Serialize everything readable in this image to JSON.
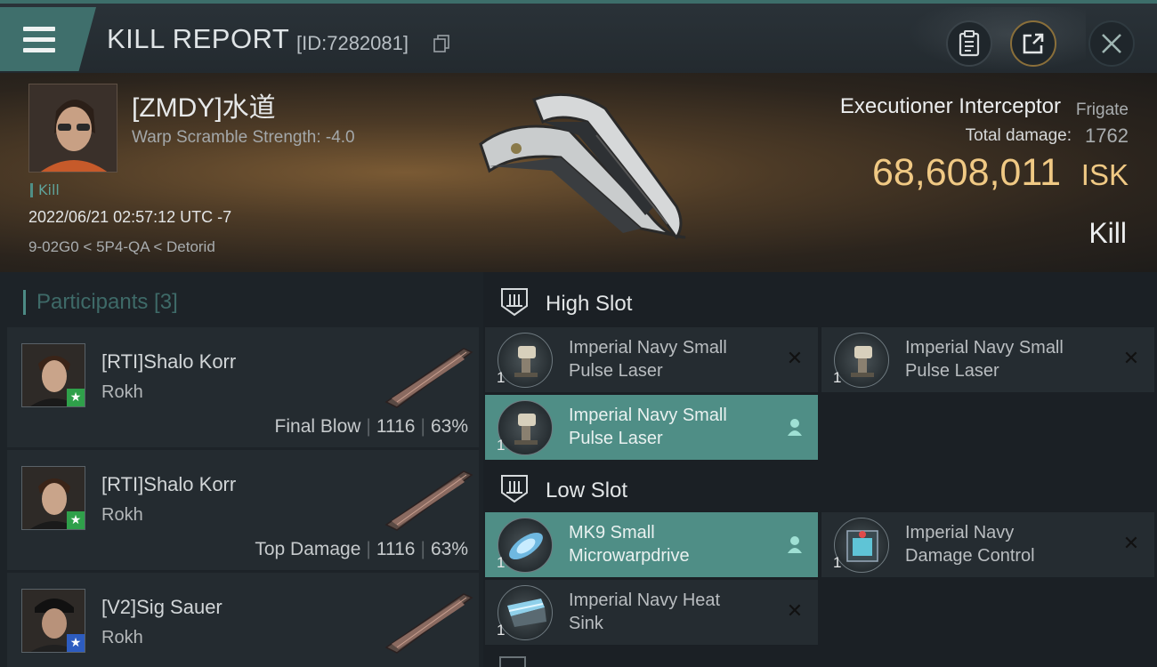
{
  "header": {
    "title": "KILL REPORT",
    "report_id": "[ID:7282081]"
  },
  "victim": {
    "name": "[ZMDY]水道",
    "warp_scramble": "Warp Scramble Strength: -4.0",
    "kill_tag": "Kill",
    "datetime": "2022/06/21 02:57:12 UTC -7",
    "location": "9-02G0 < 5P4-QA < Detorid",
    "ship_name": "Executioner Interceptor",
    "ship_class": "Frigate",
    "total_damage_label": "Total damage:",
    "total_damage": "1762",
    "isk_value": "68,608,011",
    "isk_unit": "ISK",
    "result": "Kill"
  },
  "participants": {
    "header": "Participants [3]",
    "items": [
      {
        "name": "[RTI]Shalo Korr",
        "ship": "Rokh",
        "role": "Final Blow",
        "damage": "1116",
        "percent": "63%",
        "badge": "star-green"
      },
      {
        "name": "[RTI]Shalo Korr",
        "ship": "Rokh",
        "role": "Top Damage",
        "damage": "1116",
        "percent": "63%",
        "badge": "star-green"
      },
      {
        "name": "[V2]Sig Sauer",
        "ship": "Rokh",
        "role": "",
        "damage": "",
        "percent": "",
        "badge": "star-blue"
      }
    ]
  },
  "fitting": {
    "high_slot": {
      "title": "High Slot",
      "modules": [
        {
          "name_line1": "Imperial Navy Small",
          "name_line2": "Pulse Laser",
          "qty": "1",
          "status": "destroyed"
        },
        {
          "name_line1": "Imperial Navy Small",
          "name_line2": "Pulse Laser",
          "qty": "1",
          "status": "destroyed"
        },
        {
          "name_line1": "Imperial Navy Small",
          "name_line2": "Pulse Laser",
          "qty": "1",
          "status": "dropped"
        }
      ]
    },
    "low_slot": {
      "title": "Low Slot",
      "modules": [
        {
          "name_line1": "MK9 Small",
          "name_line2": "Microwarpdrive",
          "qty": "1",
          "status": "dropped"
        },
        {
          "name_line1": "Imperial Navy",
          "name_line2": "Damage Control",
          "qty": "1",
          "status": "destroyed"
        },
        {
          "name_line1": "Imperial Navy Heat",
          "name_line2": "Sink",
          "qty": "1",
          "status": "destroyed"
        }
      ]
    }
  },
  "colors": {
    "accent_teal": "#4f8e86",
    "isk_gold": "#f0c984",
    "badge_green": "#2fa04a",
    "badge_blue": "#2d5cc0"
  },
  "icons": [
    "menu-icon",
    "copy-icon",
    "clipboard-icon",
    "share-icon",
    "close-icon",
    "high-slot-icon",
    "low-slot-icon",
    "pilot-icon",
    "destroyed-x-icon",
    "star-icon"
  ]
}
